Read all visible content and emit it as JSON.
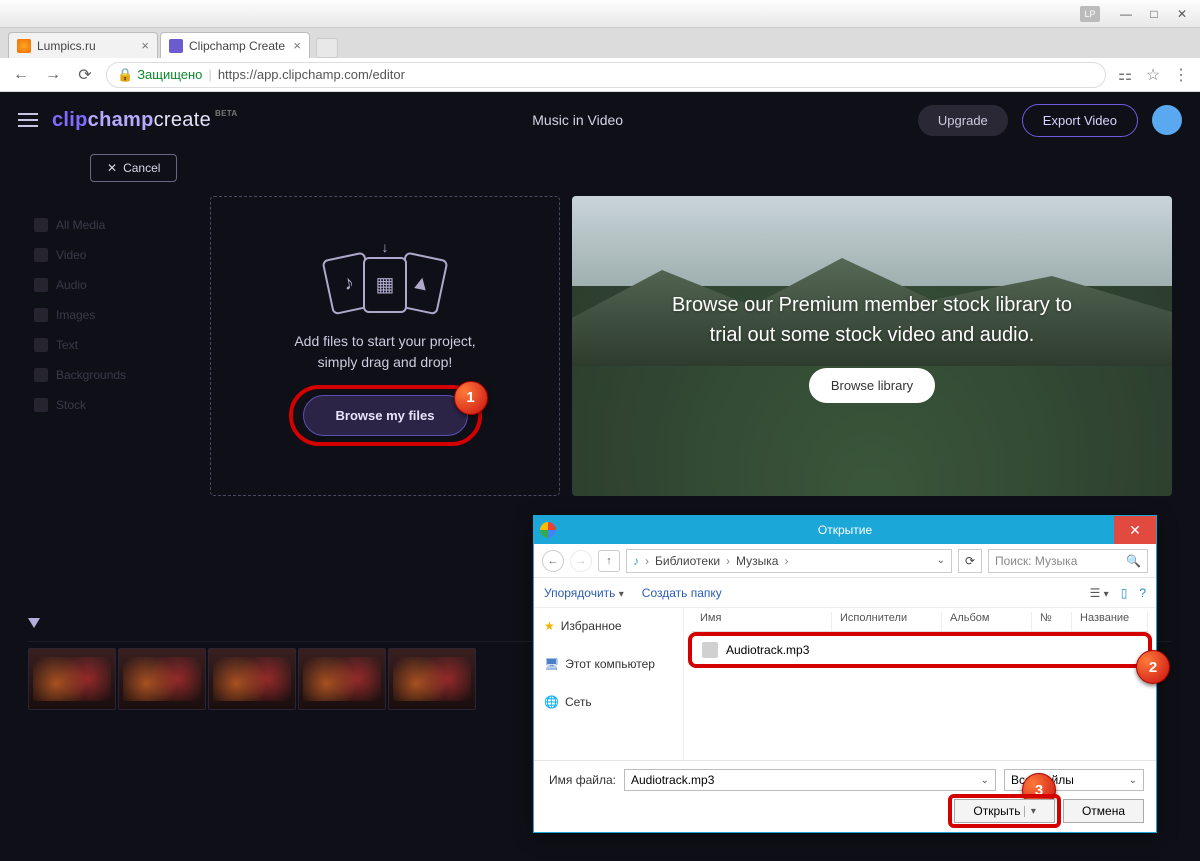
{
  "window": {
    "badge": "LP"
  },
  "tabs": [
    {
      "title": "Lumpics.ru",
      "fav": "orange",
      "active": false
    },
    {
      "title": "Clipchamp Create",
      "fav": "purple",
      "active": true
    }
  ],
  "address": {
    "secure_label": "Защищено",
    "url_prefix": "https://",
    "url_host": "app.clipchamp.com",
    "url_path": "/editor"
  },
  "app": {
    "logo": {
      "clip": "clip",
      "champ": "champ",
      "create": "create",
      "beta": "BETA"
    },
    "project_title": "Music in Video",
    "upgrade": "Upgrade",
    "export": "Export Video",
    "cancel": "Cancel",
    "sidebar": {
      "items": [
        "All Media",
        "Video",
        "Audio",
        "Images",
        "Text",
        "Backgrounds",
        "Stock"
      ]
    },
    "dropzone": {
      "line1": "Add files to start your project,",
      "line2": "simply drag and drop!",
      "browse": "Browse my files"
    },
    "stock": {
      "line1": "Browse our Premium member stock library to",
      "line2": "trial out some stock video and audio.",
      "button": "Browse library"
    }
  },
  "callouts": {
    "c1": "1",
    "c2": "2",
    "c3": "3"
  },
  "dialog": {
    "title": "Открытие",
    "breadcrumb": {
      "root": "Библиотеки",
      "folder": "Музыка"
    },
    "search_placeholder": "Поиск: Музыка",
    "toolbar": {
      "organize": "Упорядочить",
      "newfolder": "Создать папку"
    },
    "tree": {
      "fav": "Избранное",
      "pc": "Этот компьютер",
      "net": "Сеть"
    },
    "columns": {
      "name": "Имя",
      "artist": "Исполнители",
      "album": "Альбом",
      "num": "№",
      "title": "Название"
    },
    "file": "Audiotrack.mp3",
    "footer": {
      "label": "Имя файла:",
      "value": "Audiotrack.mp3",
      "filter": "Все файлы",
      "open": "Открыть",
      "cancel": "Отмена"
    }
  }
}
